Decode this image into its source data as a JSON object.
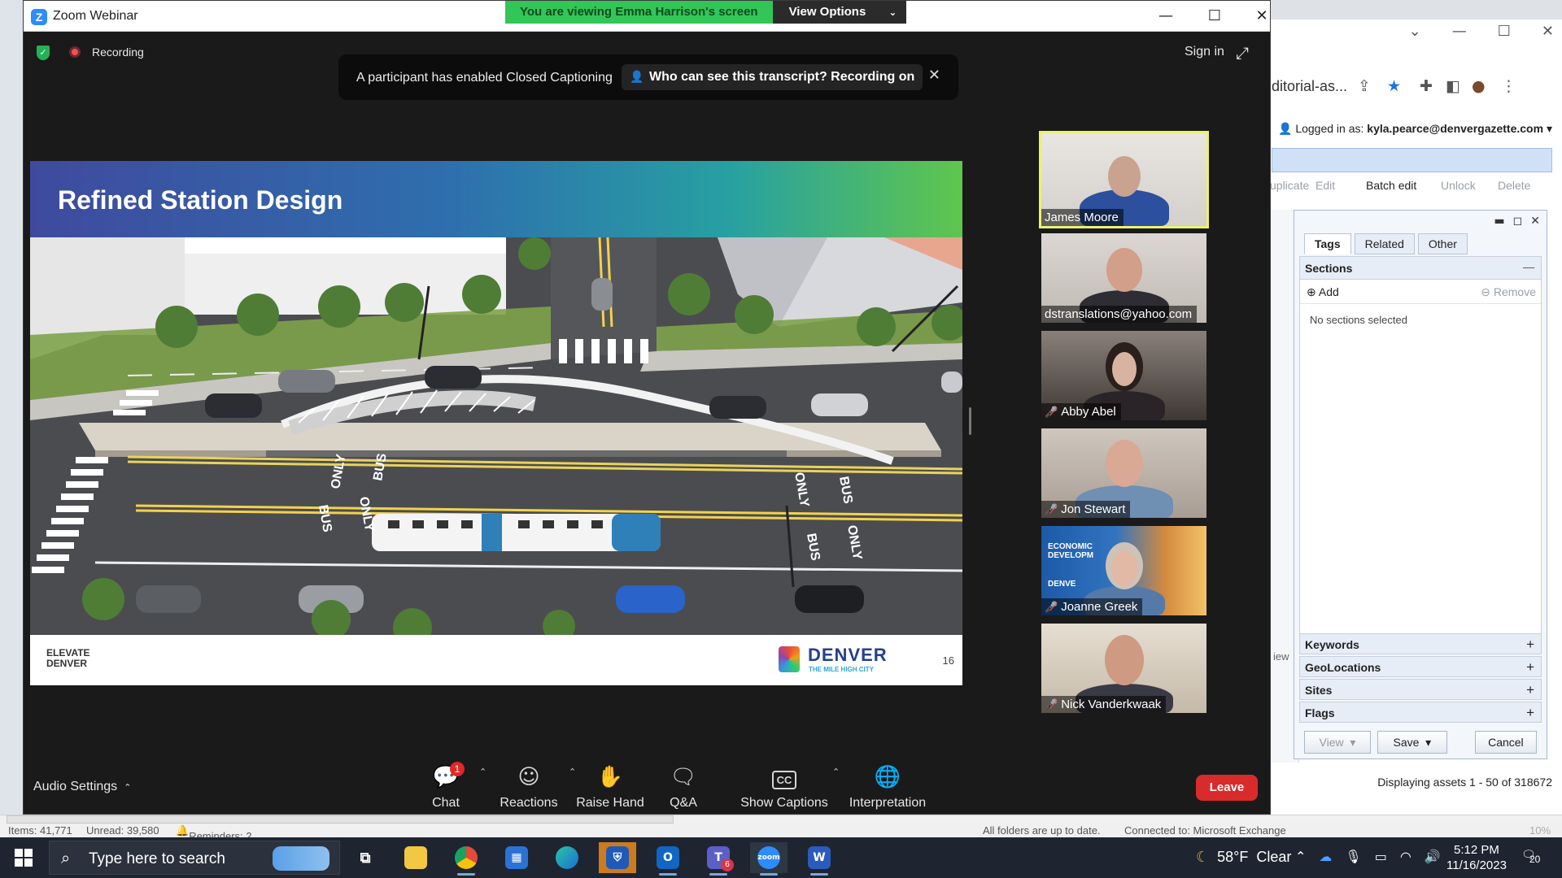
{
  "zoom": {
    "window_title": "Zoom Webinar",
    "share_banner": "You are viewing Emma Harrison's screen",
    "view_options": "View Options",
    "recording": "Recording",
    "sign_in": "Sign in",
    "cc_message": "A participant has enabled Closed Captioning",
    "cc_prompt": "Who can see this transcript? Recording on"
  },
  "slide": {
    "title": "Refined Station Design",
    "elevate_line1": "ELEVATE",
    "elevate_line2": "DENVER",
    "denver_word": "DENVER",
    "denver_tagline": "THE MILE HIGH CITY",
    "page_number": "16",
    "road_markings": [
      "ONLY",
      "BUS",
      "BUS",
      "ONLY",
      "ONLY",
      "BUS",
      "BUS",
      "ONLY"
    ]
  },
  "participants": [
    {
      "name": "James Moore",
      "muted": false,
      "active": true
    },
    {
      "name": "dstranslations@yahoo.com",
      "muted": false,
      "active": false
    },
    {
      "name": "Abby Abel",
      "muted": true,
      "active": false
    },
    {
      "name": "Jon Stewart",
      "muted": true,
      "active": false
    },
    {
      "name": "Joanne Greek",
      "muted": true,
      "active": false,
      "bg_text_1": "ECONOMIC",
      "bg_text_2": "DEVELOPM",
      "bg_text_3": "DENVE"
    },
    {
      "name": "Nick Vanderkwaak",
      "muted": true,
      "active": false
    }
  ],
  "controls": {
    "audio_settings": "Audio Settings",
    "chat": "Chat",
    "chat_badge": "1",
    "reactions": "Reactions",
    "raise_hand": "Raise Hand",
    "qa": "Q&A",
    "show_captions": "Show Captions",
    "cc_icon": "CC",
    "interpretation": "Interpretation",
    "leave": "Leave"
  },
  "browser": {
    "url_fragment": "ditorial-as...",
    "logged_in_prefix": "Logged in as:",
    "logged_in_user": "kyla.pearce@denvergazette.com",
    "toolbar": [
      "uplicate",
      "Edit",
      "Batch edit",
      "Unlock",
      "Delete"
    ],
    "tabs": [
      "Tags",
      "Related",
      "Other"
    ],
    "sections_title": "Sections",
    "add": "Add",
    "remove": "Remove",
    "no_sections": "No sections selected",
    "accordions": [
      "Keywords",
      "GeoLocations",
      "Sites",
      "Flags"
    ],
    "buttons": {
      "view": "View",
      "save": "Save",
      "cancel": "Cancel"
    },
    "side_label": "iew",
    "status": "Displaying assets 1 - 50 of 318672"
  },
  "outlook": {
    "items": "Items: 41,771",
    "unread": "Unread: 39,580",
    "reminders": "Reminders: 2",
    "sync": "All folders are up to date.",
    "connection": "Connected to: Microsoft Exchange",
    "zoom_pct": "10%"
  },
  "taskbar": {
    "search_placeholder": "Type here to search",
    "weather_temp": "58°F",
    "weather_text": "Clear",
    "time": "5:12 PM",
    "date": "11/16/2023",
    "notifications": "20",
    "teams_badge": "6"
  }
}
